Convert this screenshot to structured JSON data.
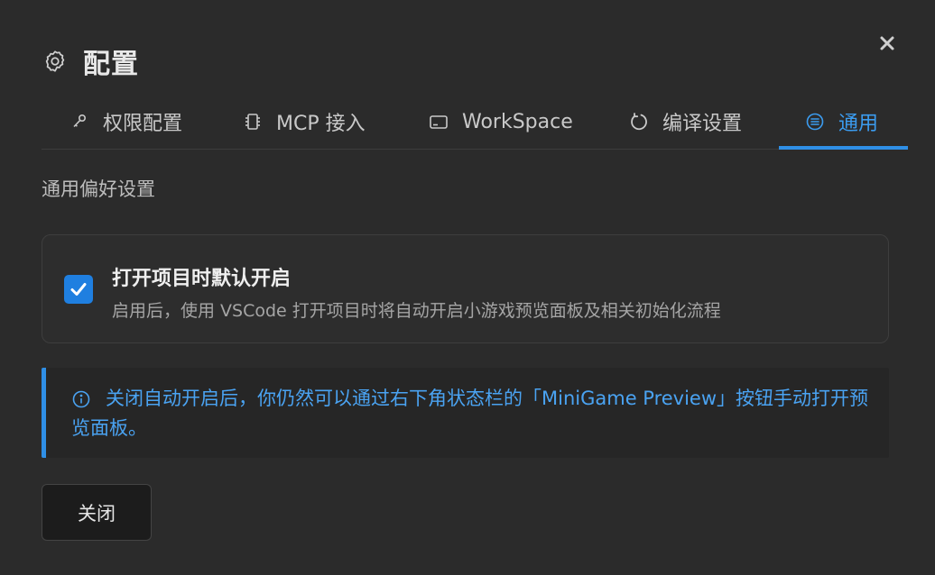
{
  "dialog": {
    "title": "配置",
    "title_icon": "gear-icon",
    "close_icon": "close-icon"
  },
  "tabs": [
    {
      "label": "权限配置",
      "icon": "key-icon",
      "active": false
    },
    {
      "label": "MCP 接入",
      "icon": "chip-icon",
      "active": false
    },
    {
      "label": "WorkSpace",
      "icon": "window-icon",
      "active": false
    },
    {
      "label": "编译设置",
      "icon": "refresh-icon",
      "active": false
    },
    {
      "label": "通用",
      "icon": "list-icon",
      "active": true
    }
  ],
  "general": {
    "section_title": "通用偏好设置",
    "option": {
      "title": "打开项目时默认开启",
      "description": "启用后，使用 VSCode 打开项目时将自动开启小游戏预览面板及相关初始化流程",
      "checked": true
    },
    "info": "关闭自动开启后，你仍然可以通过右下角状态栏的「MiniGame Preview」按钮手动打开预览面板。"
  },
  "footer": {
    "close_label": "关闭"
  },
  "colors": {
    "background": "#2b2b2b",
    "accent": "#2f8fe6",
    "info_text": "#4aa3f2",
    "checkbox": "#1f7fe0"
  }
}
